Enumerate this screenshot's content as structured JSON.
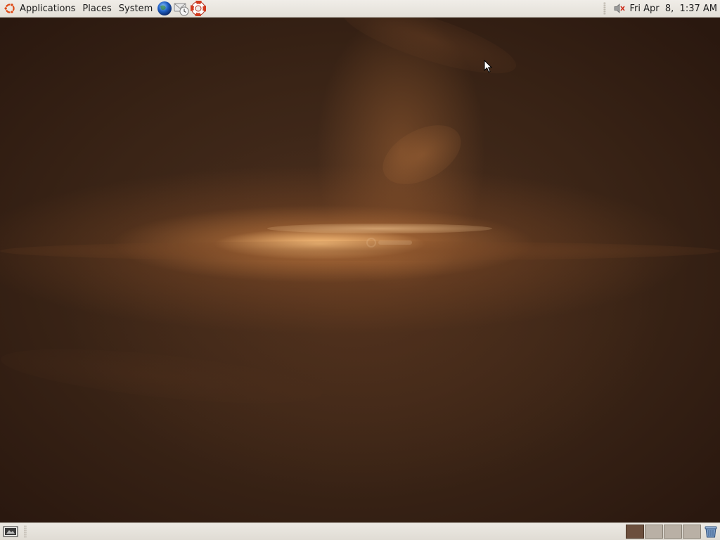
{
  "top_panel": {
    "menus": [
      {
        "label": "Applications"
      },
      {
        "label": "Places"
      },
      {
        "label": "System"
      }
    ],
    "launchers": [
      {
        "icon": "firefox-web-browser-icon"
      },
      {
        "icon": "evolution-mail-icon"
      },
      {
        "icon": "help-lifebuoy-icon"
      }
    ],
    "tray": {
      "volume_icon": "volume-muted-icon",
      "clock": "Fri Apr  8,  1:37 AM"
    }
  },
  "bottom_panel": {
    "show_desktop_icon": "show-desktop-icon",
    "workspaces": [
      {
        "active": true
      },
      {
        "active": false
      },
      {
        "active": false
      },
      {
        "active": false
      }
    ],
    "trash_icon": "trash-icon"
  },
  "colors": {
    "panel_bg": "#ece9e3",
    "wallpaper_base": "#3a2416",
    "wallpaper_glow": "#fcc480",
    "ubuntu_orange": "#dd4814",
    "workspace_active": "#6c4f3d"
  }
}
